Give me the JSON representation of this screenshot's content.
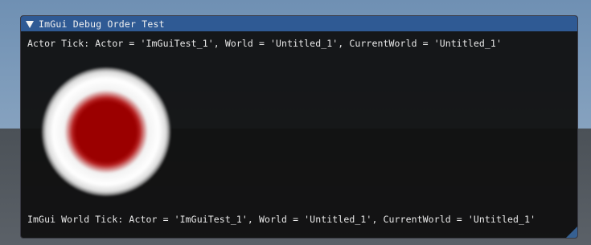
{
  "window": {
    "title": "ImGui Debug Order Test",
    "collapse_icon": "triangle-down-icon"
  },
  "log": {
    "actor_tick": "Actor Tick: Actor = 'ImGuiTest_1', World = 'Untitled_1', CurrentWorld = 'Untitled_1'",
    "world_tick": "ImGui World Tick: Actor = 'ImGuiTest_1', World = 'Untitled_1', CurrentWorld = 'Untitled_1'"
  },
  "colors": {
    "title_bar": "#2f5a94",
    "window_bg": "#0f0f0f",
    "marker_center": "#9b0000",
    "marker_ring": "#ffffff",
    "text": "#e9e9e9"
  },
  "marker": {
    "icon": "target-marker-icon"
  }
}
